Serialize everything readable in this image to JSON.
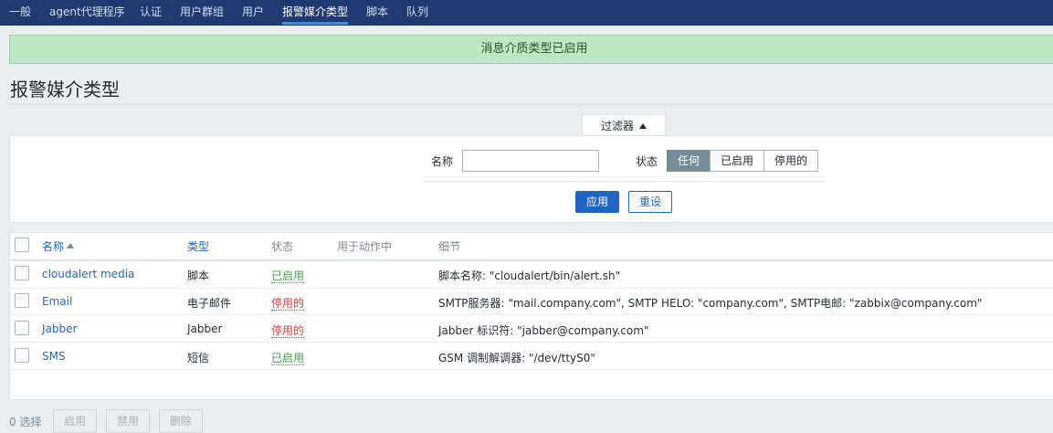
{
  "nav": {
    "items": [
      {
        "label": "一般",
        "active": false
      },
      {
        "label": "agent代理程序",
        "active": false
      },
      {
        "label": "认证",
        "active": false
      },
      {
        "label": "用户群组",
        "active": false
      },
      {
        "label": "用户",
        "active": false
      },
      {
        "label": "报警媒介类型",
        "active": true
      },
      {
        "label": "脚本",
        "active": false
      },
      {
        "label": "队列",
        "active": false
      }
    ]
  },
  "message": "消息介质类型已启用",
  "page_title": "报警媒介类型",
  "filter": {
    "tab_label": "过滤器",
    "name_label": "名称",
    "name_value": "",
    "status_label": "状态",
    "status_options": [
      "任何",
      "已启用",
      "停用的"
    ],
    "status_selected": "任何",
    "apply_label": "应用",
    "reset_label": "重设"
  },
  "table": {
    "columns": {
      "name": "名称",
      "type": "类型",
      "status": "状态",
      "used_in_actions": "用于动作中",
      "details": "细节"
    },
    "rows": [
      {
        "name": "cloudalert media",
        "type": "脚本",
        "status": "已启用",
        "used_in_actions": "",
        "details": "脚本名称: \"cloudalert/bin/alert.sh\""
      },
      {
        "name": "Email",
        "type": "电子邮件",
        "status": "停用的",
        "used_in_actions": "",
        "details": "SMTP服务器: \"mail.company.com\", SMTP HELO: \"company.com\", SMTP电邮: \"zabbix@company.com\""
      },
      {
        "name": "Jabber",
        "type": "Jabber",
        "status": "停用的",
        "used_in_actions": "",
        "details": "Jabber 标识符: \"jabber@company.com\""
      },
      {
        "name": "SMS",
        "type": "短信",
        "status": "已启用",
        "used_in_actions": "",
        "details": "GSM 调制解调器: \"/dev/ttyS0\""
      }
    ]
  },
  "footer": {
    "selected_count": "0 选择",
    "enable_label": "启用",
    "disable_label": "禁用",
    "delete_label": "删除"
  },
  "colors": {
    "nav_bg": "#1f3a6f",
    "success_bg": "#bde8c6",
    "link": "#1f65c4",
    "enabled": "#429e47",
    "disabled": "#e33734"
  }
}
